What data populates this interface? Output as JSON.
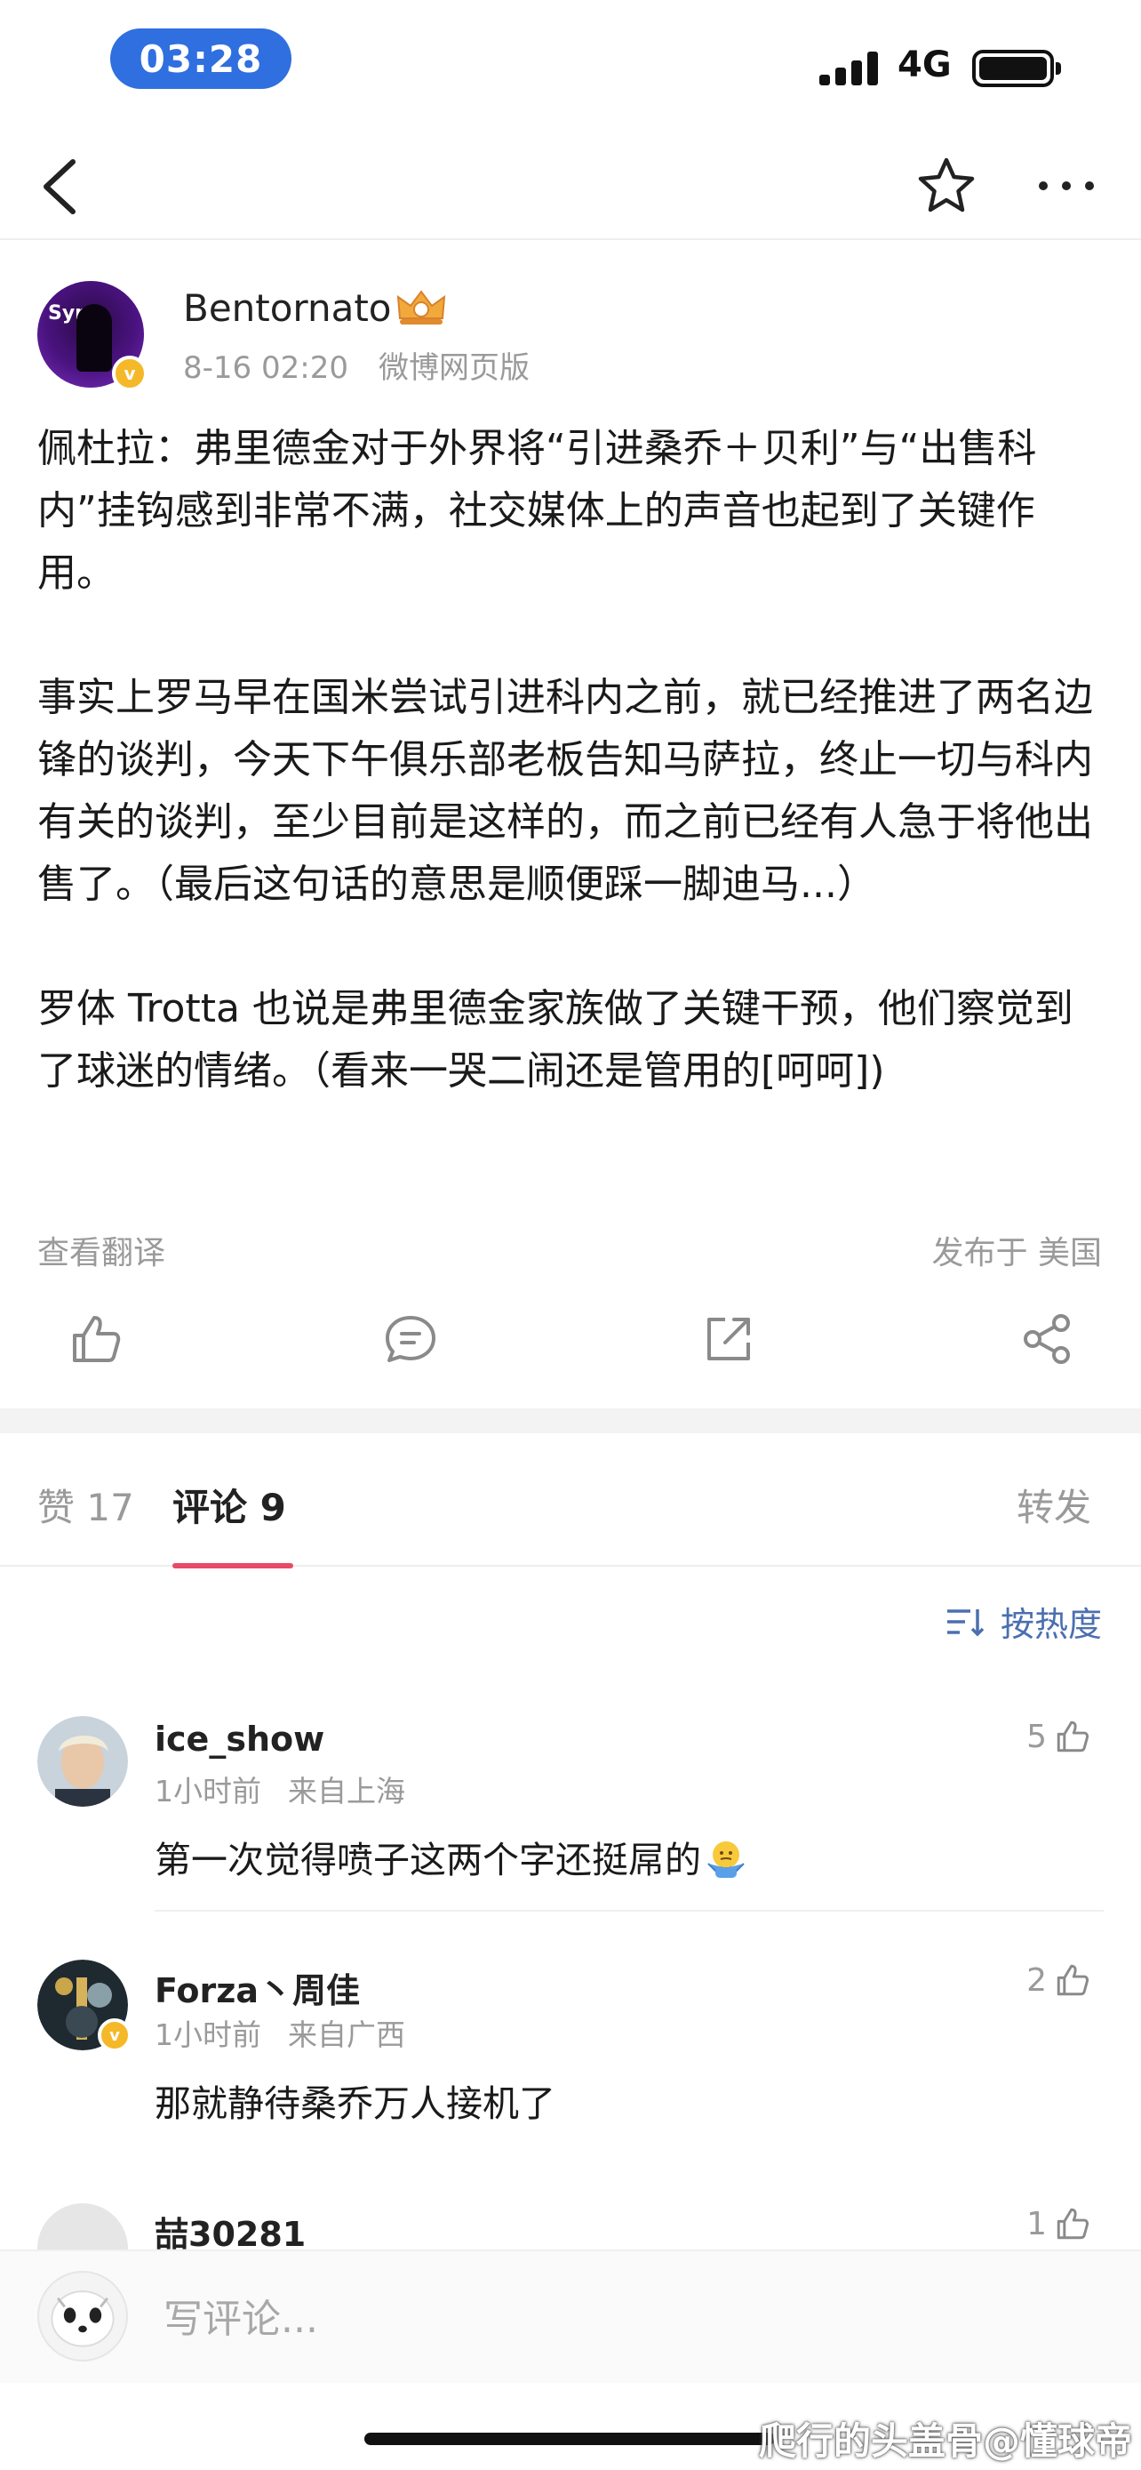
{
  "status_bar": {
    "time": "03:28",
    "network": "4G"
  },
  "post": {
    "username": "Bentornato",
    "timestamp": "8-16 02:20",
    "source": "微博网页版",
    "avatar_text": "Syn",
    "verified_badge": "v",
    "paragraphs": [
      "佩杜拉：弗里德金对于外界将“引进桑乔＋贝利”与“出售科内”挂钩感到非常不满，社交媒体上的声音也起到了关键作用。",
      "事实上罗马早在国米尝试引进科内之前，就已经推进了两名边锋的谈判，今天下午俱乐部老板告知马萨拉，终止一切与科内有关的谈判，至少目前是这样的，而之前已经有人急于将他出售了。（最后这句话的意思是顺便踩一脚迪马...）",
      "罗体 Trotta 也说是弗里德金家族做了关键干预，他们察觉到了球迷的情绪。（看来一哭二闹还是管用的[呵呵])"
    ],
    "translate_label": "查看翻译",
    "location_label": "发布于 美国"
  },
  "tabs": {
    "likes": "赞 17",
    "comments": "评论 9",
    "reposts": "转发"
  },
  "sort_label": "按热度",
  "comments": [
    {
      "name": "ice_show",
      "time": "1小时前",
      "location": "来自上海",
      "text": "第一次觉得喷子这两个字还挺屌的",
      "likes": "5"
    },
    {
      "name": "Forza丶周佳",
      "time": "1小时前",
      "location": "来自广西",
      "text": "那就静待桑乔万人接机了",
      "likes": "2"
    },
    {
      "name": "喆30281",
      "time": "",
      "location": "",
      "text": "",
      "likes": "1"
    }
  ],
  "input_placeholder": "写评论...",
  "watermark": "爬行的头盖骨@懂球帝",
  "colors": {
    "accent_blue": "#2f6fe0",
    "tab_underline": "#e84a67",
    "sort_blue": "#4b6fb0",
    "verified": "#f5b829"
  }
}
